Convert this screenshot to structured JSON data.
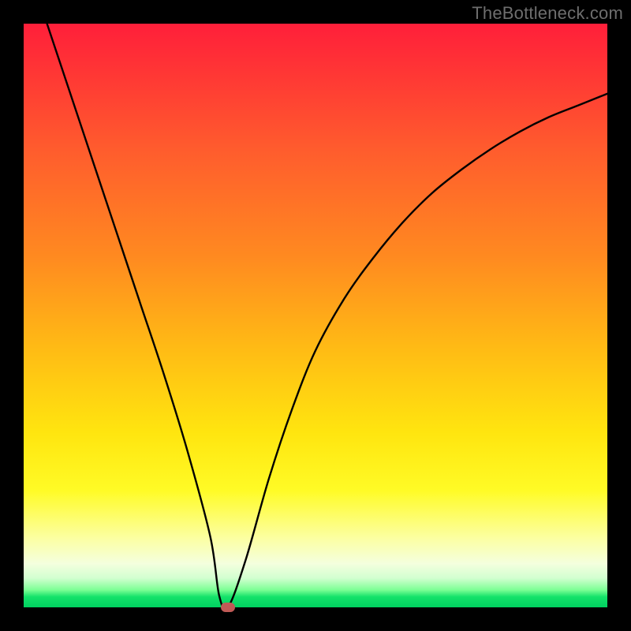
{
  "watermark": "TheBottleneck.com",
  "chart_data": {
    "type": "line",
    "title": "",
    "xlabel": "",
    "ylabel": "",
    "xlim": [
      0,
      100
    ],
    "ylim": [
      0,
      100
    ],
    "grid": false,
    "legend": false,
    "background_gradient": {
      "top_color": "#ff1f3a",
      "mid_color": "#ffe50f",
      "bottom_color": "#00d160"
    },
    "series": [
      {
        "name": "bottleneck-curve",
        "color": "#000000",
        "x": [
          4,
          8,
          12,
          16,
          20,
          24,
          28,
          32,
          33.5,
          35,
          38,
          42,
          46,
          50,
          55,
          60,
          65,
          70,
          75,
          80,
          85,
          90,
          95,
          100
        ],
        "y": [
          100,
          88,
          76,
          64,
          52,
          40,
          27,
          12,
          2,
          0,
          8,
          22,
          34,
          44,
          53,
          60,
          66,
          71,
          75,
          78.5,
          81.5,
          84,
          86,
          88
        ]
      }
    ],
    "marker": {
      "name": "optimal-point",
      "x": 35,
      "y": 0,
      "color": "#c05a56"
    }
  }
}
